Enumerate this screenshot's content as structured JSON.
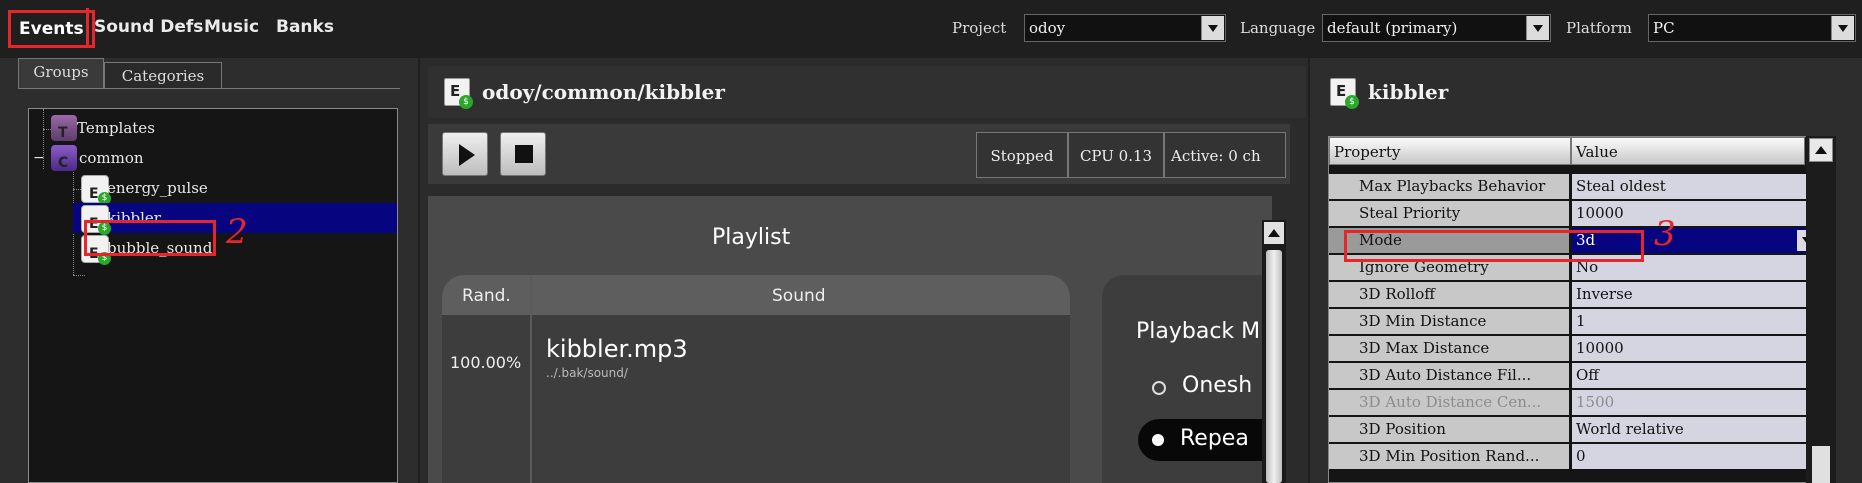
{
  "top_nav": {
    "items": [
      {
        "label": "Events",
        "active": true
      },
      {
        "label": "Sound Defs"
      },
      {
        "label": "Music"
      },
      {
        "label": "Banks"
      }
    ],
    "project_label": "Project",
    "project_value": "odoy",
    "language_label": "Language",
    "language_value": "default (primary)",
    "platform_label": "Platform",
    "platform_value": "PC"
  },
  "left_panel": {
    "tabs": [
      "Groups",
      "Categories"
    ],
    "tree": [
      {
        "label": "Templates",
        "icon": "template-icon",
        "letter": "T"
      },
      {
        "label": "common",
        "icon": "category-icon",
        "letter": "C",
        "expand": "−"
      },
      {
        "label": "energy_pulse",
        "icon": "event-icon",
        "letter": "E"
      },
      {
        "label": "kibbler",
        "icon": "event-icon",
        "letter": "E",
        "selected": true
      },
      {
        "label": "bubble_sound",
        "icon": "event-icon",
        "letter": "E"
      }
    ]
  },
  "middle_panel": {
    "path": "odoy/common/kibbler",
    "status": "Stopped",
    "cpu": "CPU 0.13",
    "active": "Active: 0 ch",
    "playlist_title": "Playlist",
    "col_rand": "Rand.",
    "col_sound": "Sound",
    "row_percent": "100.00%",
    "row_sound": "kibbler.mp3",
    "row_path": "../.bak/sound/",
    "playback_title": "Playback M",
    "opt_oneshot": "Onesh",
    "opt_repeat": "Repea"
  },
  "right_panel": {
    "title": "kibbler",
    "col_property": "Property",
    "col_value": "Value",
    "rows": [
      {
        "name": "Max Playbacks Behavior",
        "value": "Steal oldest"
      },
      {
        "name": "Steal Priority",
        "value": "10000"
      },
      {
        "name": "Mode",
        "value": "3d",
        "selected": true
      },
      {
        "name": "Ignore Geometry",
        "value": "No"
      },
      {
        "name": "3D Rolloff",
        "value": "Inverse"
      },
      {
        "name": "3D Min Distance",
        "value": "1"
      },
      {
        "name": "3D Max Distance",
        "value": "10000"
      },
      {
        "name": "3D Auto Distance Fil...",
        "value": "Off"
      },
      {
        "name": "3D Auto Distance Cen...",
        "value": "1500",
        "disabled": true
      },
      {
        "name": "3D Position",
        "value": "World relative"
      },
      {
        "name": "3D Min Position Rand...",
        "value": "0"
      }
    ]
  },
  "annotations": [
    "2",
    "3"
  ]
}
